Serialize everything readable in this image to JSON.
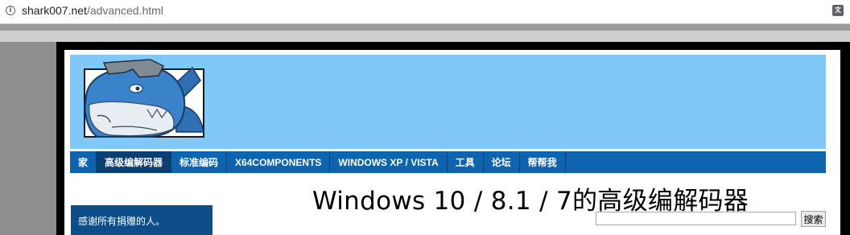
{
  "browser": {
    "url_host": "shark007.net",
    "url_path": "/advanced.html",
    "info_icon": "info-icon",
    "translate_icon": "translate-icon"
  },
  "nav": {
    "items": [
      {
        "label": "家",
        "active": false
      },
      {
        "label": "高级编解码器",
        "active": true
      },
      {
        "label": "标准编码",
        "active": false
      },
      {
        "label": "X64COMPONENTS",
        "active": false
      },
      {
        "label": "WINDOWS XP / VISTA",
        "active": false
      },
      {
        "label": "工具",
        "active": false
      },
      {
        "label": "论坛",
        "active": false
      },
      {
        "label": "帮帮我",
        "active": false
      }
    ]
  },
  "main": {
    "title": "Windows 10 / 8.1 / 7的高级编解码器"
  },
  "sidebar": {
    "text": "感谢所有捐赠的人。"
  },
  "search": {
    "value": "",
    "button_label": "搜索"
  },
  "colors": {
    "header_bg": "#80c8f8",
    "nav_bg": "#0e64ae",
    "nav_active": "#0b3f72",
    "sidebar_bg": "#0e4e88"
  }
}
